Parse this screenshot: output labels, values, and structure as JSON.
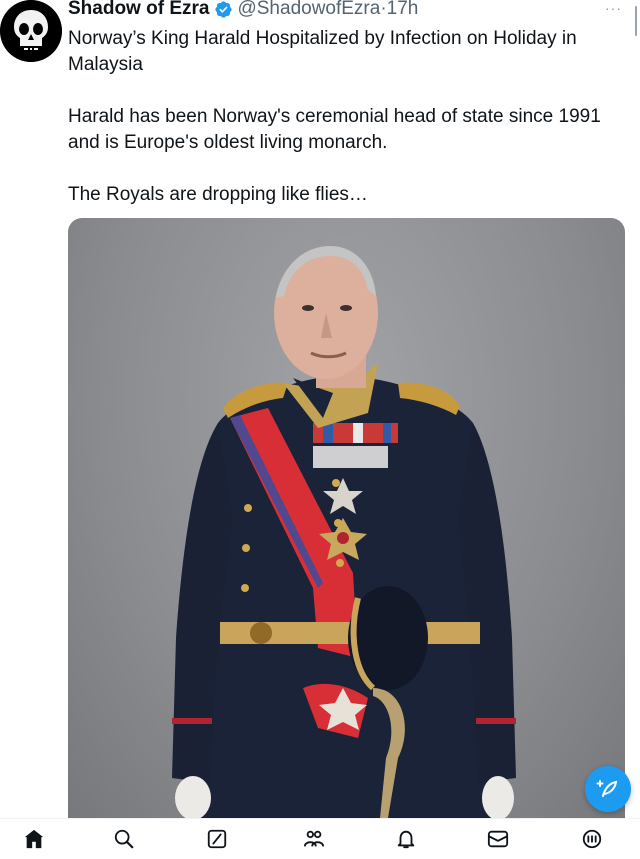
{
  "tweet": {
    "author_name": "Shadow of Ezra",
    "handle": "@ShadowofEzra",
    "separator": "·",
    "time": "17h",
    "more_label": "···",
    "text": [
      "Norway’s King Harald Hospitalized by Infection on Holiday in Malaysia",
      "Harald has been Norway's ceremonial head of state since 1991 and is Europe's oldest living monarch.",
      "The Royals are dropping like flies…"
    ]
  },
  "icons": {
    "avatar": "punisher-skull-icon",
    "verified": "verified-badge-icon",
    "compose": "compose-feather-icon",
    "nav": [
      "home-icon",
      "search-icon",
      "grok-icon",
      "communities-icon",
      "notifications-icon",
      "messages-icon",
      "premium-icon"
    ]
  },
  "colors": {
    "accent": "#1d9bf0",
    "text": "#0f1419",
    "secondary": "#536471"
  }
}
